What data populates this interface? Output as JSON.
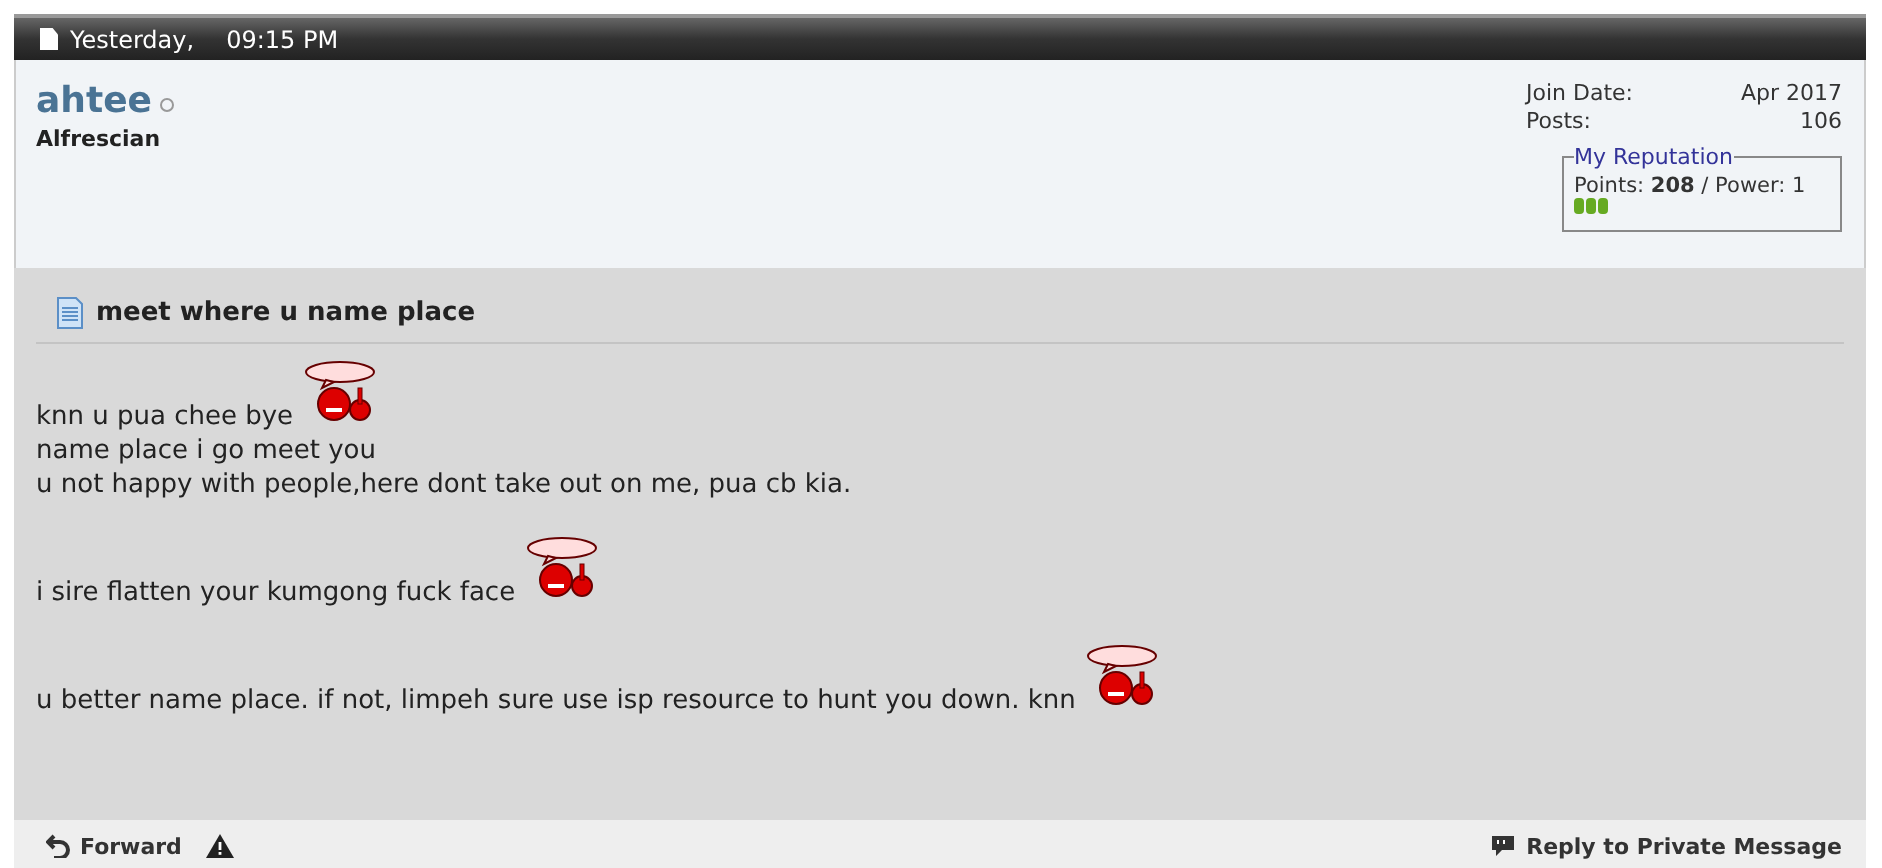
{
  "header": {
    "date": "Yesterday,",
    "time": "09:15 PM"
  },
  "user": {
    "name": "ahtee",
    "online": false,
    "title": "Alfrescian",
    "details": [
      {
        "label": "Join Date:",
        "value": "Apr 2017"
      },
      {
        "label": "Posts:",
        "value": "106"
      }
    ],
    "reputation": {
      "legend": "My Reputation",
      "points_label": "Points:",
      "points": "208",
      "power_label": "/ Power:",
      "power": "1",
      "stars": 3
    }
  },
  "post": {
    "title": "meet where u name place",
    "lines": [
      {
        "text": "knn u pua chee bye",
        "smiley": true
      },
      {
        "text": "name place i go meet you",
        "smiley": false
      },
      {
        "text": "u not happy with people,here dont take out on me, pua cb kia.",
        "smiley": false
      },
      {
        "smiley": false
      },
      {
        "text": "i sire flatten your kumgong fuck face",
        "smiley": true
      },
      {
        "smiley": false
      },
      {
        "text": "u better name place. if not, limpeh sure use isp resource to hunt you down. knn",
        "smiley": true
      }
    ]
  },
  "footer": {
    "forward": "Forward",
    "reply": "Reply to Private Message"
  }
}
